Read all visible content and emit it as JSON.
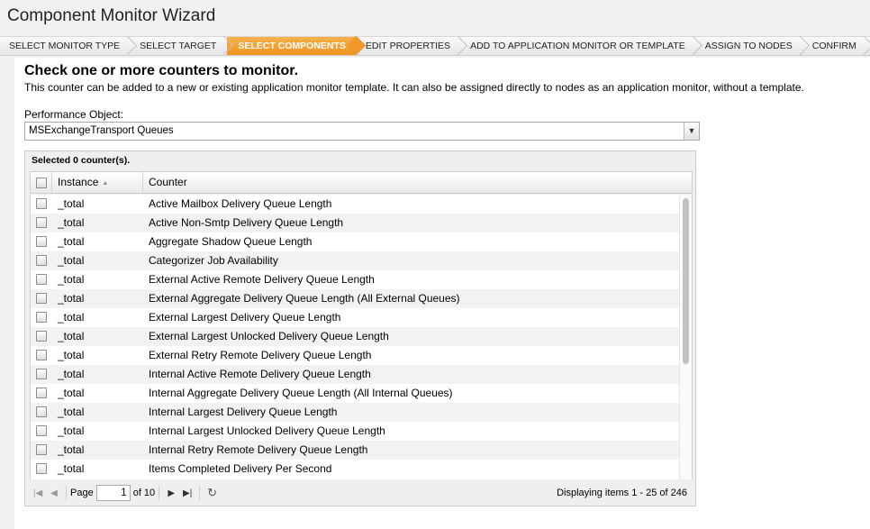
{
  "window": {
    "title": "Component Monitor Wizard"
  },
  "wizard_steps": [
    {
      "label": "SELECT MONITOR TYPE",
      "active": false
    },
    {
      "label": "SELECT TARGET",
      "active": false
    },
    {
      "label": "SELECT COMPONENTS",
      "active": true
    },
    {
      "label": "EDIT PROPERTIES",
      "active": false
    },
    {
      "label": "ADD TO APPLICATION MONITOR OR TEMPLATE",
      "active": false
    },
    {
      "label": "ASSIGN TO NODES",
      "active": false
    },
    {
      "label": "CONFIRM",
      "active": false
    }
  ],
  "main": {
    "heading": "Check one or more counters to monitor.",
    "description": "This counter can be added to a new or existing application monitor template. It can also be assigned directly to nodes as an application monitor, without a template.",
    "performance_object": {
      "label": "Performance Object:",
      "value": "MSExchangeTransport Queues"
    }
  },
  "grid": {
    "caption": "Selected 0 counter(s).",
    "columns": {
      "instance": "Instance",
      "counter": "Counter"
    },
    "rows": [
      {
        "instance": "_total",
        "counter": "Active Mailbox Delivery Queue Length"
      },
      {
        "instance": "_total",
        "counter": "Active Non-Smtp Delivery Queue Length"
      },
      {
        "instance": "_total",
        "counter": "Aggregate Shadow Queue Length"
      },
      {
        "instance": "_total",
        "counter": "Categorizer Job Availability"
      },
      {
        "instance": "_total",
        "counter": "External Active Remote Delivery Queue Length"
      },
      {
        "instance": "_total",
        "counter": "External Aggregate Delivery Queue Length (All External Queues)"
      },
      {
        "instance": "_total",
        "counter": "External Largest Delivery Queue Length"
      },
      {
        "instance": "_total",
        "counter": "External Largest Unlocked Delivery Queue Length"
      },
      {
        "instance": "_total",
        "counter": "External Retry Remote Delivery Queue Length"
      },
      {
        "instance": "_total",
        "counter": "Internal Active Remote Delivery Queue Length"
      },
      {
        "instance": "_total",
        "counter": "Internal Aggregate Delivery Queue Length (All Internal Queues)"
      },
      {
        "instance": "_total",
        "counter": "Internal Largest Delivery Queue Length"
      },
      {
        "instance": "_total",
        "counter": "Internal Largest Unlocked Delivery Queue Length"
      },
      {
        "instance": "_total",
        "counter": "Internal Retry Remote Delivery Queue Length"
      },
      {
        "instance": "_total",
        "counter": "Items Completed Delivery Per Second"
      }
    ],
    "pager": {
      "page_label": "Page",
      "page_value": "1",
      "of_label": "of 10",
      "display_info": "Displaying items 1 - 25 of 246"
    }
  },
  "colors": {
    "active_step": "#f0982a",
    "panel_bg": "#ffffff",
    "page_bg": "#f1f1f1"
  }
}
